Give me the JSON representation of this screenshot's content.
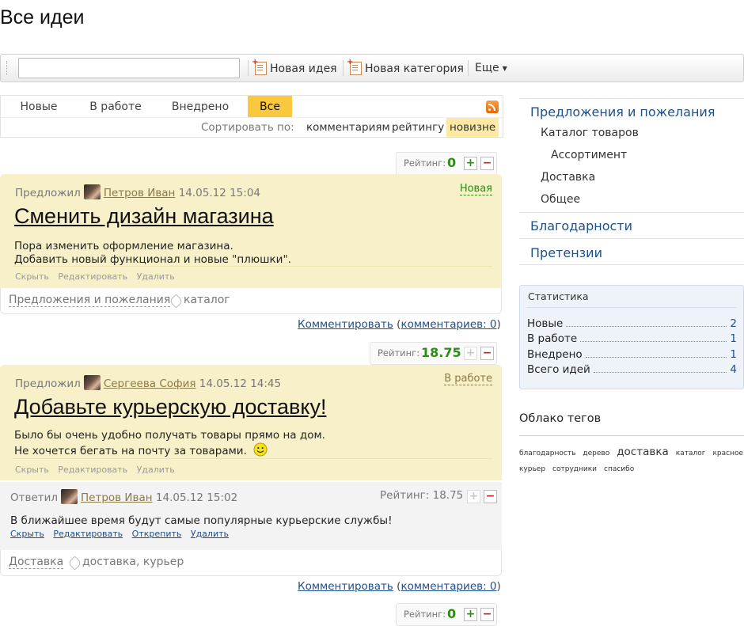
{
  "page_title": "Все идеи",
  "toolbar": {
    "search_value": "",
    "new_idea": "Новая идея",
    "new_category": "Новая категория",
    "more": "Еще"
  },
  "tabs": [
    "Новые",
    "В работе",
    "Внедрено",
    "Все"
  ],
  "active_tab": "Все",
  "sort": {
    "label": "Сортировать по:",
    "options": [
      "комментариям",
      "рейтингу",
      "новизне"
    ],
    "active": "новизне"
  },
  "ideas": [
    {
      "rating_label": "Рейтинг:",
      "rating": "0",
      "author_prefix": "Предложил",
      "author": "Петров Иван",
      "date": "14.05.12 15:04",
      "status": "Новая",
      "title": "Сменить дизайн магазина",
      "body": [
        "Пора изменить оформление магазина.",
        "Добавить новый функционал и новые \"плюшки\"."
      ],
      "actions": [
        "Скрыть",
        "Редактировать",
        "Удалить"
      ],
      "category": "Предложения и пожелания",
      "tags": "каталог",
      "comment_link": "Комментировать",
      "comments_count": "комментариев: 0"
    },
    {
      "rating_label": "Рейтинг:",
      "rating": "18.75",
      "author_prefix": "Предложил",
      "author": "Сергеева София",
      "date": "14.05.12 14:45",
      "status": "В работе",
      "title": "Добавьте курьерскую доставку!",
      "body": [
        "Было бы очень удобно получать товары прямо на дом.",
        "Не хочется бегать на почту за товарами."
      ],
      "actions": [
        "Скрыть",
        "Редактировать",
        "Удалить"
      ],
      "answer": {
        "prefix": "Ответил",
        "author": "Петров Иван",
        "date": "14.05.12 15:02",
        "rating_text": "Рейтинг: 18.75",
        "text": "В ближайшее время будут самые популярные курьерские службы!",
        "actions": [
          "Скрыть",
          "Редактировать",
          "Открепить",
          "Удалить"
        ]
      },
      "category": "Доставка",
      "tags": "доставка, курьер",
      "comment_link": "Комментировать",
      "comments_count": "комментариев: 0"
    }
  ],
  "third_rating": {
    "label": "Рейтинг:",
    "value": "0"
  },
  "sidebar": {
    "categories": [
      {
        "label": "Предложения и пожелания",
        "children": [
          {
            "label": "Каталог товаров",
            "children": [
              {
                "label": "Ассортимент"
              }
            ]
          },
          {
            "label": "Доставка"
          },
          {
            "label": "Общее"
          }
        ]
      },
      {
        "label": "Благодарности"
      },
      {
        "label": "Претензии"
      }
    ],
    "stats": {
      "title": "Статистика",
      "rows": [
        {
          "label": "Новые",
          "value": "2"
        },
        {
          "label": "В работе",
          "value": "1"
        },
        {
          "label": "Внедрено",
          "value": "1"
        },
        {
          "label": "Всего идей",
          "value": "4"
        }
      ]
    },
    "tag_cloud": {
      "title": "Облако тегов",
      "tags": [
        "благодарность",
        "дерево",
        "доставка",
        "каталог",
        "красное",
        "курьер",
        "сотрудники",
        "спасибо"
      ]
    }
  },
  "colors": {
    "idea_bg": "#f7f0c8",
    "active_tab": "#f9c83d",
    "link": "#1f4f8a",
    "rating_green": "#2e8b15"
  }
}
